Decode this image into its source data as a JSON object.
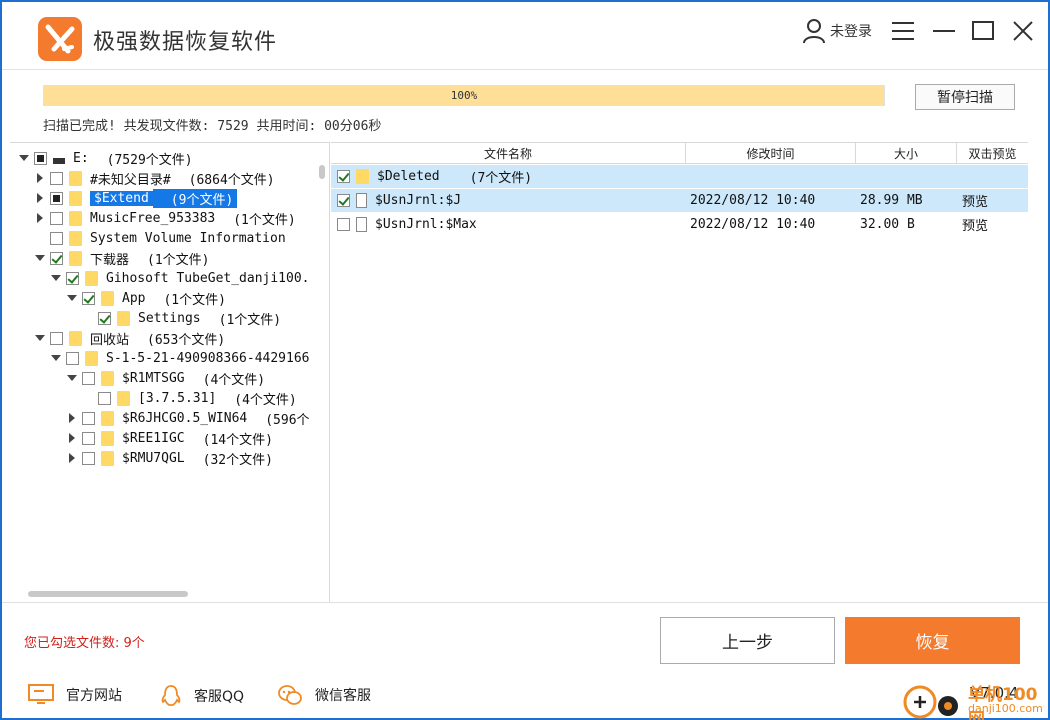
{
  "app": {
    "title": "极强数据恢复软件",
    "user_label": "未登录"
  },
  "colors": {
    "accent": "#f47a2e",
    "selection": "#1479e6",
    "row_highlight": "#cce8fa",
    "progress": "#fddf97",
    "warning_text": "#d0201a"
  },
  "icons": {
    "user": "user-icon",
    "menu": "menu-icon",
    "minimize": "minimize-icon",
    "maximize": "maximize-icon",
    "close": "close-icon"
  },
  "scan": {
    "progress_percent": 100,
    "progress_label": "100%",
    "pause_label": "暂停扫描",
    "status": "扫描已完成! 共发现文件数: 7529  共用时间: 00分06秒"
  },
  "tree": [
    {
      "name": "E:",
      "count": "(7529个文件)",
      "check": "partial",
      "arrow": "open",
      "icon": "drive",
      "indent": 0,
      "selected": false
    },
    {
      "name": "#未知父目录#",
      "count": "(6864个文件)",
      "check": "none",
      "arrow": "closed",
      "icon": "folder",
      "indent": 1,
      "selected": false
    },
    {
      "name": "$Extend",
      "count": "(9个文件)",
      "check": "partial",
      "arrow": "closed",
      "icon": "folder",
      "indent": 1,
      "selected": true
    },
    {
      "name": "MusicFree_953383",
      "count": "(1个文件)",
      "check": "none",
      "arrow": "closed",
      "icon": "folder",
      "indent": 1,
      "selected": false
    },
    {
      "name": "System Volume Information",
      "count": "",
      "check": "none",
      "arrow": "none",
      "icon": "folder",
      "indent": 1,
      "selected": false
    },
    {
      "name": "下载器",
      "count": "(1个文件)",
      "check": "checked",
      "arrow": "open",
      "icon": "folder",
      "indent": 1,
      "selected": false
    },
    {
      "name": "Gihosoft TubeGet_danji100.",
      "count": "",
      "check": "checked",
      "arrow": "open",
      "icon": "folder",
      "indent": 2,
      "selected": false
    },
    {
      "name": "App",
      "count": "(1个文件)",
      "check": "checked",
      "arrow": "open",
      "icon": "folder",
      "indent": 3,
      "selected": false
    },
    {
      "name": "Settings",
      "count": "(1个文件)",
      "check": "checked",
      "arrow": "none",
      "icon": "folder",
      "indent": 4,
      "selected": false
    },
    {
      "name": "回收站",
      "count": "(653个文件)",
      "check": "none",
      "arrow": "open",
      "icon": "folder",
      "indent": 1,
      "selected": false
    },
    {
      "name": "S-1-5-21-490908366-4429166",
      "count": "",
      "check": "none",
      "arrow": "open",
      "icon": "folder",
      "indent": 2,
      "selected": false
    },
    {
      "name": "$R1MTSGG",
      "count": "(4个文件)",
      "check": "none",
      "arrow": "open",
      "icon": "folder",
      "indent": 3,
      "selected": false
    },
    {
      "name": "[3.7.5.31]",
      "count": "(4个文件)",
      "check": "none",
      "arrow": "none",
      "icon": "folder",
      "indent": 4,
      "selected": false
    },
    {
      "name": "$R6JHCG0.5_WIN64",
      "count": "(596个",
      "check": "none",
      "arrow": "closed",
      "icon": "folder",
      "indent": 3,
      "selected": false
    },
    {
      "name": "$REE1IGC",
      "count": "(14个文件)",
      "check": "none",
      "arrow": "closed",
      "icon": "folder",
      "indent": 3,
      "selected": false
    },
    {
      "name": "$RMU7QGL",
      "count": "(32个文件)",
      "check": "none",
      "arrow": "closed",
      "icon": "folder",
      "indent": 3,
      "selected": false
    }
  ],
  "file_table": {
    "headers": [
      "文件名称",
      "修改时间",
      "大小",
      "双击预览"
    ],
    "rows": [
      {
        "name": "$Deleted",
        "count": "(7个文件)",
        "time": "",
        "size": "",
        "preview": "",
        "checked": true,
        "icon": "folder",
        "highlight": true
      },
      {
        "name": "$UsnJrnl:$J",
        "count": "",
        "time": "2022/08/12 10:40",
        "size": "28.99 MB",
        "preview": "预览",
        "checked": true,
        "icon": "file",
        "highlight": true
      },
      {
        "name": "$UsnJrnl:$Max",
        "count": "",
        "time": "2022/08/12 10:40",
        "size": "32.00 B",
        "preview": "预览",
        "checked": false,
        "icon": "file",
        "highlight": false
      }
    ]
  },
  "bottom": {
    "selected_count": "您已勾选文件数: 9个",
    "prev_label": "上一步",
    "recover_label": "恢复"
  },
  "footer": {
    "links": [
      {
        "label": "官方网站",
        "icon": "monitor-icon"
      },
      {
        "label": "客服QQ",
        "icon": "qq-icon"
      },
      {
        "label": "微信客服",
        "icon": "wechat-icon"
      }
    ],
    "version": "V7.0.4",
    "watermark_line1": "单机100网",
    "watermark_line2": "danji100.com"
  }
}
